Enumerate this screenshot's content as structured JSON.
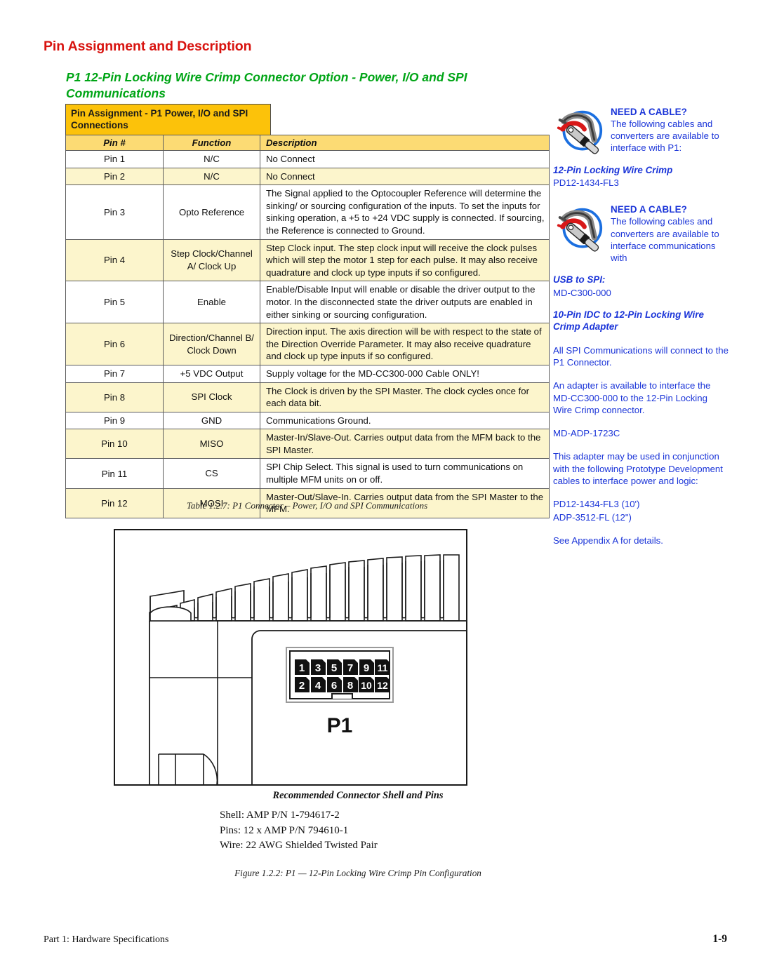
{
  "heading": {
    "section_title": "Pin Assignment and Description",
    "sub_title": "P1 12-Pin Locking Wire Crimp Connector Option - Power, I/O and SPI Communications"
  },
  "colors": {
    "section_title_red": "#d8130f",
    "sub_title_green": "#00a516",
    "table_title_gold": "#fcc20a",
    "table_header_yellow": "#fcdb74",
    "row_alt_cream": "#fcf5cc",
    "sidebar_blue": "#1a34d8"
  },
  "table": {
    "title": "Pin Assignment - P1 Power,  I/O and SPI Connections",
    "columns": [
      "Pin #",
      "Function",
      "Description"
    ],
    "rows": [
      {
        "pin": "Pin 1",
        "function": "N/C",
        "description": "No Connect"
      },
      {
        "pin": "Pin 2",
        "function": "N/C",
        "description": "No Connect"
      },
      {
        "pin": "Pin 3",
        "function": "Opto Reference",
        "description": "The Signal applied to the Optocoupler Reference will determine the sinking/ or sourcing configuration of the inputs. To set the inputs for sinking operation, a +5 to +24 VDC supply is connected. If sourcing, the Reference is connected to Ground."
      },
      {
        "pin": "Pin 4",
        "function": "Step Clock/Channel A/ Clock Up",
        "description": "Step Clock input. The step clock input will receive the clock pulses which will step the motor 1 step for each pulse. It may also receive quadrature and clock up type inputs if so configured."
      },
      {
        "pin": "Pin 5",
        "function": "Enable",
        "description": "Enable/Disable Input will enable or disable the driver output to the motor. In the disconnected state the driver outputs are enabled in either sinking or sourcing configuration."
      },
      {
        "pin": "Pin 6",
        "function": "Direction/Channel B/ Clock Down",
        "description": "Direction input. The axis direction will be with respect to the state of the Direction Override Parameter. It may also receive quadrature and clock up type inputs if so configured."
      },
      {
        "pin": "Pin 7",
        "function": "+5 VDC Output",
        "description": "Supply voltage for the MD-CC300-000 Cable ONLY!"
      },
      {
        "pin": "Pin 8",
        "function": "SPI Clock",
        "description": "The Clock is driven by the SPI Master. The clock cycles once for each data bit."
      },
      {
        "pin": "Pin 9",
        "function": "GND",
        "description": "Communications Ground."
      },
      {
        "pin": "Pin 10",
        "function": "MISO",
        "description": "Master-In/Slave-Out. Carries output data from the MFM back to the SPI Master."
      },
      {
        "pin": "Pin 11",
        "function": "CS",
        "description": "SPI Chip Select. This signal is used to turn communications on multiple MFM units on or off."
      },
      {
        "pin": "Pin 12",
        "function": "MOSI",
        "description": "Master-Out/Slave-In. Carries output data from the SPI Master to the MFM."
      }
    ],
    "caption": "Table 1.2.7: P1 Connector – Power, I/O and SPI Communications"
  },
  "sidebar": {
    "callout_1": {
      "icon": "cable-connector-icon",
      "heading": "NEED A CABLE?",
      "text": "The following cables and converters are available to interface with P1:"
    },
    "callout_1_items": [
      {
        "title": "12-Pin Locking Wire Crimp",
        "value": "PD12-1434-FL3"
      }
    ],
    "callout_2": {
      "icon": "cable-connector-icon",
      "heading": "NEED A CABLE?",
      "text": "The following cables and converters are available to interface communications with"
    },
    "callout_2_items": [
      {
        "title": "USB to SPI:",
        "value": "MD-C300-000"
      }
    ],
    "adapter_heading": "10-Pin IDC to 12-Pin Locking Wire Crimp Adapter",
    "paragraphs": [
      "All SPI Communications will connect to the P1 Connector.",
      "An adapter is available to interface the MD-CC300-000 to the 12-Pin Locking Wire Crimp connector.",
      "MD-ADP-1723C",
      "This adapter may be used in conjunction with the following Prototype Development cables to interface power and logic:"
    ],
    "cable_list": [
      "PD12-1434-FL3 (10')",
      "ADP-3512-FL (12\")"
    ],
    "see_appendix": "See Appendix A for details."
  },
  "figure": {
    "connector_label": "P1",
    "pins_top": [
      "1",
      "3",
      "5",
      "7",
      "9",
      "11"
    ],
    "pins_bottom": [
      "2",
      "4",
      "6",
      "8",
      "10",
      "12"
    ],
    "shell_title": "Recommended Connector Shell and Pins",
    "shell_lines": [
      "Shell: AMP P/N 1-794617-2",
      "Pins: 12 x AMP P/N 794610-1",
      "Wire: 22 AWG Shielded Twisted Pair"
    ],
    "caption": "Figure 1.2.2: P1 — 12-Pin Locking Wire Crimp Pin Configuration"
  },
  "footer": {
    "left": "Part 1: Hardware Specifications",
    "page": "1-9"
  }
}
